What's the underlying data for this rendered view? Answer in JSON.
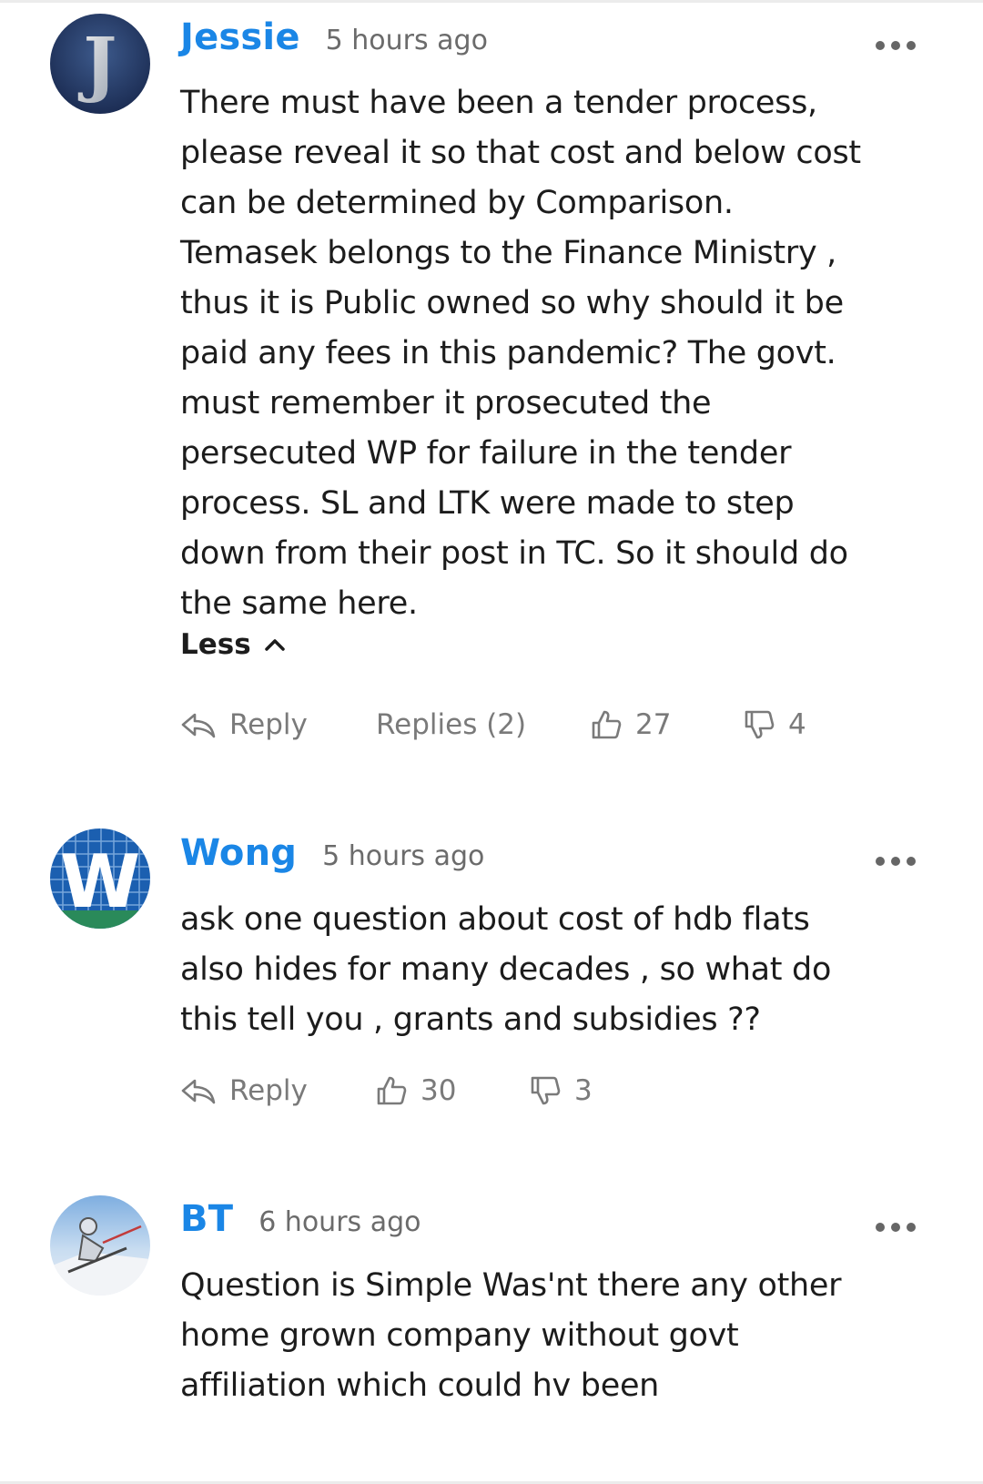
{
  "comments": [
    {
      "author": "Jessie",
      "time": "5 hours ago",
      "avatar_letter": "J",
      "lines": [
        "There must have been a tender process,",
        "please reveal it so that cost and below cost",
        "can be determined by Comparison.",
        "Temasek belongs to the Finance Ministry ,",
        "thus it is Public owned so why should it be",
        "paid any fees in this pandemic? The govt.",
        "must remember it prosecuted the",
        "persecuted WP for failure in the tender",
        "process. SL and LTK were made to step",
        "down from their post in TC. So it should do",
        "the same here."
      ],
      "less_label": "Less",
      "reply_label": "Reply",
      "replies_label": "Replies (2)",
      "likes": "27",
      "dislikes": "4"
    },
    {
      "author": "Wong",
      "time": "5 hours ago",
      "avatar_letter": "W",
      "lines": [
        "ask one question about cost of hdb flats",
        "also hides for many decades , so what do",
        "this tell you , grants and subsidies ??"
      ],
      "reply_label": "Reply",
      "likes": "30",
      "dislikes": "3"
    },
    {
      "author": "BT",
      "time": "6 hours ago",
      "lines": [
        "Question is Simple Was'nt there any other",
        "home grown company without govt",
        "affiliation which could hv been"
      ]
    }
  ],
  "icons": {
    "more": "more-dots-icon",
    "reply": "reply-arrow-icon",
    "like": "thumbs-up-icon",
    "dislike": "thumbs-down-icon",
    "collapse": "chevron-up-icon"
  },
  "colors": {
    "author": "#1a86e6",
    "meta": "#6b6b6b",
    "action": "#7a7a7a"
  }
}
